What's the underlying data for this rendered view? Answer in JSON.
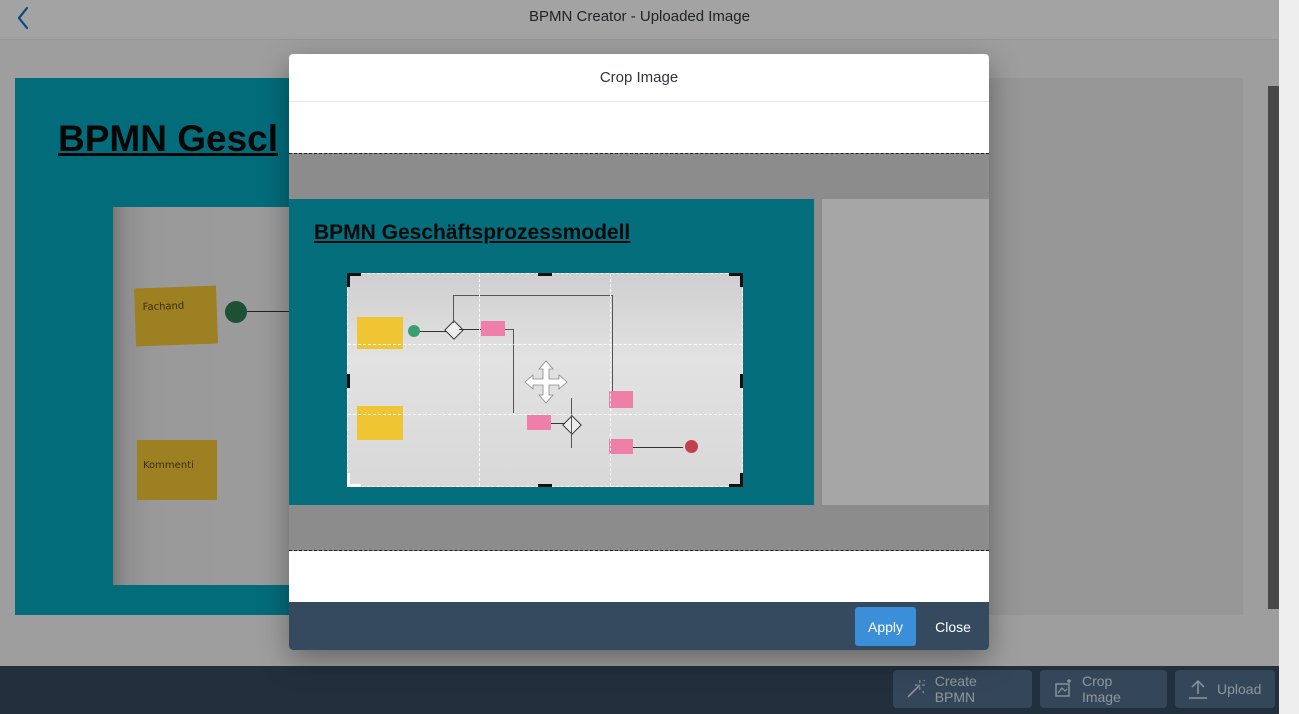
{
  "shell": {
    "title": "BPMN Creator - Uploaded Image",
    "back_icon": "chevron-left-icon"
  },
  "slide": {
    "title": "BPMN Geschäftsprozessmodell",
    "title_visible": "BPMN Gescl",
    "note_labels": [
      "Fachand",
      "Kommenti"
    ]
  },
  "dialog": {
    "title": "Crop Image",
    "apply_label": "Apply",
    "close_label": "Close"
  },
  "footer": {
    "create_bpmn_label": "Create BPMN",
    "crop_image_label": "Crop Image",
    "upload_label": "Upload"
  },
  "colors": {
    "shell_bar": "#354a5f",
    "accent": "#3b8ed8",
    "slide_teal": "#06a6bd"
  }
}
